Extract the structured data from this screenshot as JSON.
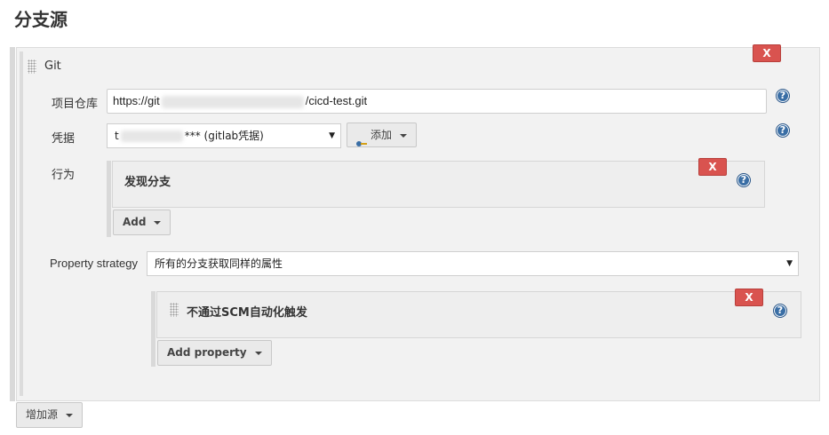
{
  "section_title": "分支源",
  "git_block": {
    "title": "Git",
    "delete_label": "X",
    "repo_label": "项目仓库",
    "repo_value_prefix": "https://git",
    "repo_value_suffix": "/cicd-test.git",
    "credentials_label": "凭据",
    "credentials_prefix": "t",
    "credentials_suffix": "*** (gitlab凭据)",
    "add_credentials_label": "添加",
    "behaviors_label": "行为",
    "help_label": "?",
    "behavior": {
      "title": "发现分支",
      "delete_label": "X"
    },
    "add_behavior_label": "Add",
    "property_strategy_label": "Property strategy",
    "property_strategy_value": "所有的分支获取同样的属性",
    "property": {
      "title": "不通过SCM自动化触发",
      "delete_label": "X"
    },
    "add_property_label": "Add property"
  },
  "add_source_label": "增加源",
  "colors": {
    "delete": "#d9534f",
    "help": "#3a6ea5"
  }
}
